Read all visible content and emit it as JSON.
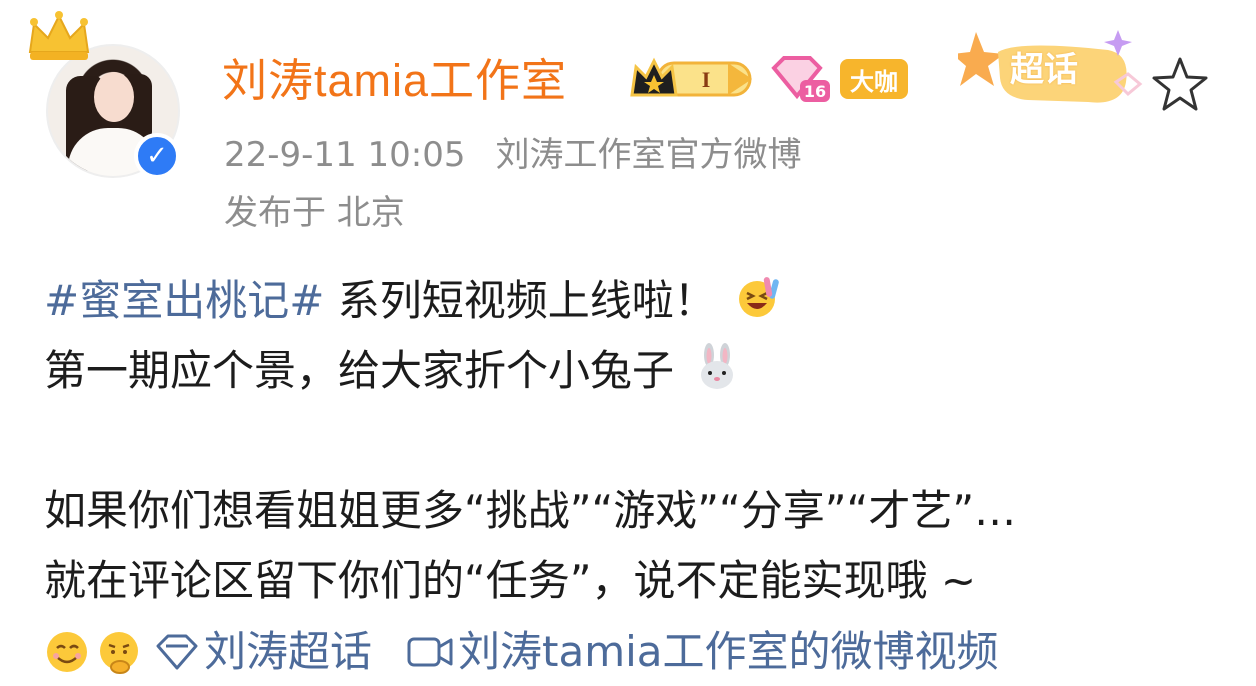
{
  "profile": {
    "username": "刘涛tamia工作室",
    "vip_level": "I",
    "level_number": "16",
    "daka_label": "大咖",
    "chaohua_label": "超话"
  },
  "post": {
    "timestamp": "22-9-11 10:05",
    "source": "刘涛工作室官方微博",
    "location": "发布于 北京",
    "topic": "#蜜室出桃记#",
    "line1_rest": " 系列短视频上线啦！",
    "line2": "第一期应个景，给大家折个小兔子",
    "line3": "如果你们想看姐姐更多“挑战”“游戏”“分享”“才艺”…",
    "line4": "就在评论区留下你们的“任务”，说不定能实现哦 ~"
  },
  "footer": {
    "super_topic_link": "刘涛超话",
    "video_link": "刘涛tamia工作室的微博视频"
  },
  "colors": {
    "username": "#f27418",
    "link": "#4d6b9a",
    "meta": "#8d8d8d",
    "verified": "#2e7bf6",
    "daka": "#f7b52c"
  },
  "icons": [
    "crown-icon",
    "verified-icon",
    "vip-crown-badge-icon",
    "level-diamond-icon",
    "star-icon",
    "laughing-emoji-icon",
    "rabbit-emoji-icon",
    "smile-emoji-icon",
    "thinking-emoji-icon",
    "super-topic-diamond-icon",
    "video-camera-icon"
  ]
}
